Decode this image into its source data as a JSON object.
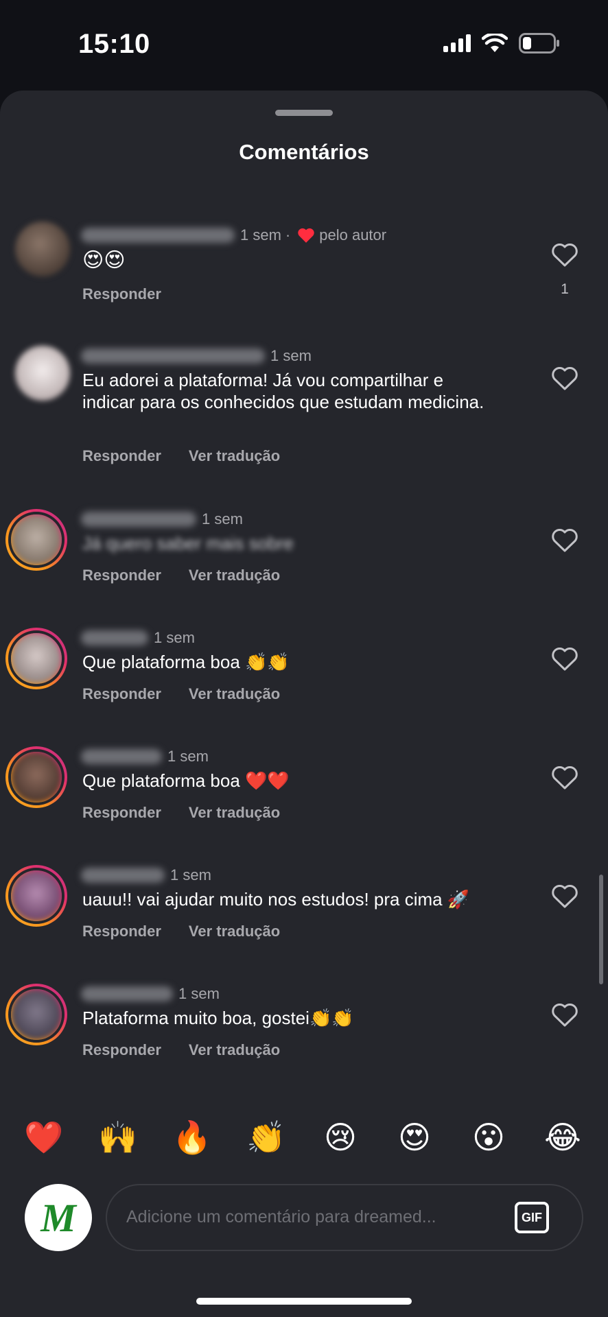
{
  "status_bar": {
    "time": "15:10",
    "icons": [
      "cellular-signal-icon",
      "wifi-icon",
      "battery-icon"
    ]
  },
  "sheet": {
    "title": "Comentários"
  },
  "comments": [
    {
      "time": "1 sem",
      "liked_by_author_label": "pelo autor",
      "text": "😍😍",
      "reply_label": "Responder",
      "like_count": "1",
      "avatar_color": "#6b5a4e"
    },
    {
      "time": "1 sem",
      "text": "Eu adorei a plataforma! Já vou compartilhar e indicar para os conhecidos que estudam medicina.",
      "reply_label": "Responder",
      "translate_label": "Ver tradução",
      "avatar_color": "#d7cfcf"
    },
    {
      "time": "1 sem",
      "text": "Já quero saber mais sobre",
      "reply_label": "Responder",
      "translate_label": "Ver tradução",
      "avatar_color": "#a8998c"
    },
    {
      "time": "1 sem",
      "text": "Que plataforma boa 👏👏",
      "reply_label": "Responder",
      "translate_label": "Ver tradução",
      "avatar_color": "#b8aaa6"
    },
    {
      "time": "1 sem",
      "text": "Que plataforma boa ❤️❤️",
      "reply_label": "Responder",
      "translate_label": "Ver tradução",
      "avatar_color": "#6e5146"
    },
    {
      "time": "1 sem",
      "text": "uauu!! vai ajudar muito nos estudos! pra cima 🚀",
      "reply_label": "Responder",
      "translate_label": "Ver tradução",
      "avatar_color": "#8a5e88"
    },
    {
      "time": "1 sem",
      "text": "Plataforma muito boa, gostei👏👏",
      "reply_label": "Responder",
      "translate_label": "Ver tradução",
      "avatar_color": "#5c5566"
    }
  ],
  "reactions": [
    "❤️",
    "🙌",
    "🔥",
    "👏",
    "😢",
    "😍",
    "😮",
    "😂"
  ],
  "composer": {
    "avatar_letter": "M",
    "placeholder": "Adicione um comentário para dreamed...",
    "gif_label": "GIF"
  },
  "colors": {
    "sheet_bg": "#25262c",
    "page_bg": "#101116",
    "secondary_text": "#a8a8ad",
    "heart_red": "#ff2d3f",
    "brand_green": "#1f8a2a"
  }
}
